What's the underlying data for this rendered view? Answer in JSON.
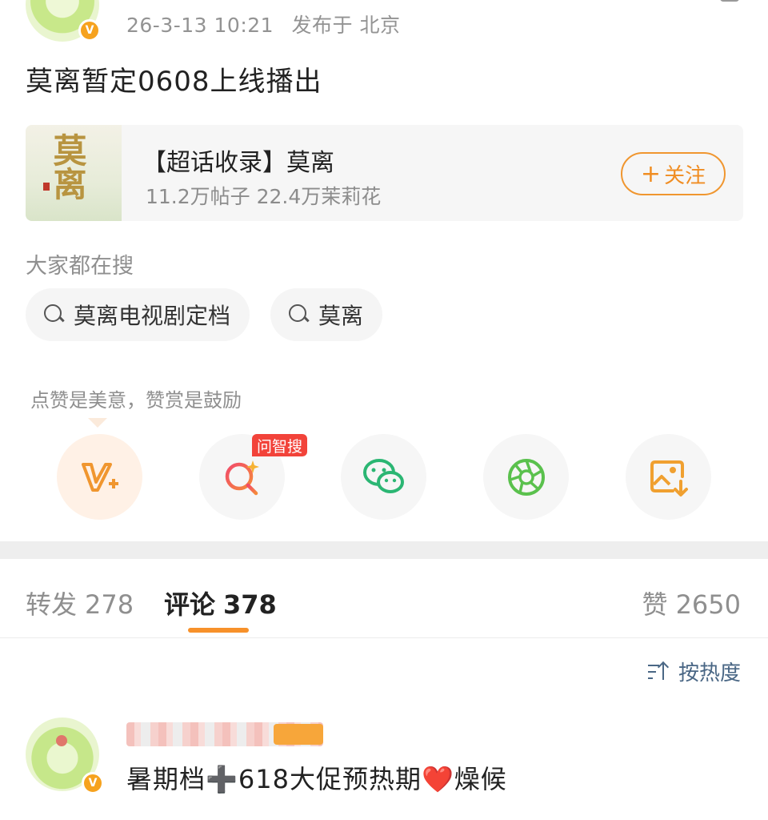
{
  "post": {
    "timestamp": "26-3-13 10:21",
    "location": "发布于 北京",
    "text": "莫离暂定0608上线播出"
  },
  "topic": {
    "thumb_text": "莫离",
    "title": "【超话收录】莫离",
    "stats": "11.2万帖子 22.4万茉莉花",
    "follow_label": "关注",
    "follow_plus": "+"
  },
  "search": {
    "heading": "大家都在搜",
    "chips": [
      "莫离电视剧定档",
      "莫离"
    ]
  },
  "tip": "点赞是美意，赞赏是鼓励",
  "actions": {
    "ai_badge": "问智搜",
    "items": [
      "reward-icon",
      "ai-search-icon",
      "wechat-icon",
      "moments-icon",
      "save-image-icon"
    ]
  },
  "tabs": {
    "repost_label": "转发",
    "repost_count": "278",
    "comment_label": "评论",
    "comment_count": "378",
    "like_label": "赞",
    "like_count": "2650"
  },
  "sort_label": "按热度",
  "comment": {
    "text_a": "暑期档",
    "cross": "➕",
    "text_b": "618大促预热期",
    "heart": "❤️",
    "text_c": "燥候"
  },
  "colors": {
    "accent": "#f7912a",
    "follow": "#f08d22",
    "link": "#4a6785",
    "badge_red": "#f2433a"
  }
}
